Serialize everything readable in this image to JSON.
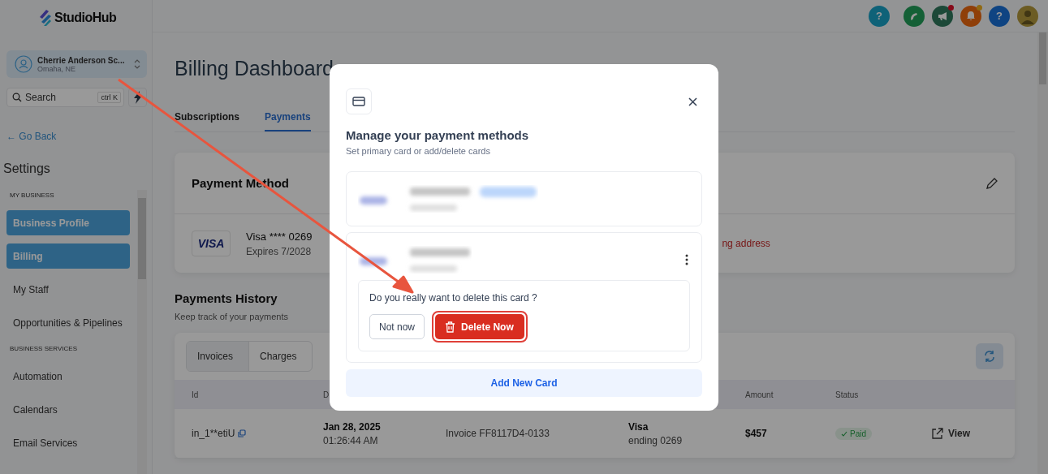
{
  "sidebar": {
    "brand": "StudioHub",
    "account": {
      "name": "Cherrie Anderson Sc...",
      "location": "Omaha, NE"
    },
    "search": {
      "placeholder": "Search",
      "shortcut": "ctrl K"
    },
    "back_link": "← Go Back",
    "title": "Settings",
    "sections": [
      {
        "label": "MY BUSINESS",
        "items": [
          {
            "label": "Business Profile",
            "selected": true
          },
          {
            "label": "Billing",
            "selected": true
          },
          {
            "label": "My Staff",
            "selected": false
          },
          {
            "label": "Opportunities & Pipelines",
            "selected": false
          }
        ]
      },
      {
        "label": "BUSINESS SERVICES",
        "items": [
          {
            "label": "Automation",
            "selected": false
          },
          {
            "label": "Calendars",
            "selected": false
          },
          {
            "label": "Email Services",
            "selected": false
          }
        ]
      }
    ]
  },
  "topbar": {
    "buttons": [
      {
        "kind": "help",
        "label": "?",
        "notified": false
      },
      {
        "kind": "phone",
        "notified": false
      },
      {
        "kind": "megaphone",
        "notified": true
      },
      {
        "kind": "bell",
        "notified": true
      },
      {
        "kind": "help2",
        "label": "?",
        "notified": false
      },
      {
        "kind": "avatar",
        "notified": false
      }
    ]
  },
  "page": {
    "title": "Billing Dashboard",
    "tabs": [
      {
        "label": "Subscriptions",
        "selected": false
      },
      {
        "label": "Payments",
        "selected": true
      }
    ],
    "payment_method": {
      "title": "Payment Method",
      "brand": "VISA",
      "card": "Visa **** 0269",
      "expires": "Expires 7/2028",
      "side_warning": "ng address"
    },
    "history": {
      "title": "Payments History",
      "subtitle": "Keep track of your payments",
      "segments": [
        {
          "label": "Invoices",
          "selected": true
        },
        {
          "label": "Charges",
          "selected": false
        }
      ],
      "columns": [
        "Id",
        "D",
        "Amount",
        "Status"
      ],
      "rows": [
        {
          "id": "in_1**etiU",
          "date": "Jan 28, 2025",
          "time": "01:26:44 AM",
          "description": "Invoice FF8117D4-0133",
          "method": "Visa",
          "method_detail": "ending 0269",
          "amount": "$457",
          "status": "Paid",
          "action": "View"
        }
      ]
    }
  },
  "modal": {
    "title": "Manage your payment methods",
    "subtitle": "Set primary card or add/delete cards",
    "cards": [
      {
        "has_menu": false
      },
      {
        "has_menu": true,
        "confirm": {
          "question": "Do you really want to delete this card ?",
          "cancel": "Not now",
          "delete": "Delete Now"
        }
      }
    ],
    "add_button": "Add New Card"
  },
  "annotation": {
    "arrow": true,
    "highlight": true
  }
}
